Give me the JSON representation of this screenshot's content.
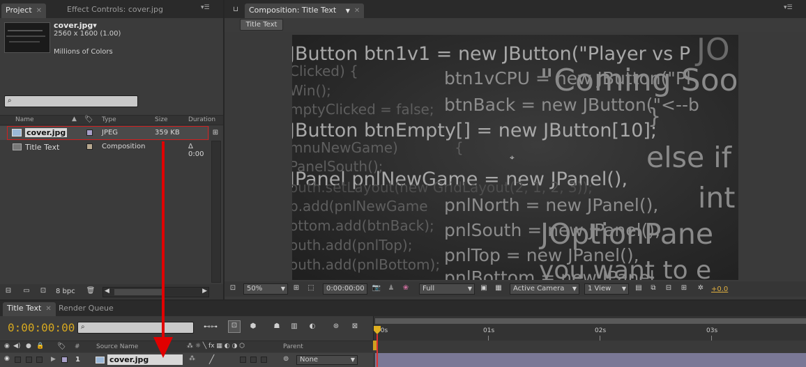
{
  "project_panel": {
    "tab_project": "Project",
    "tab_effect_controls": "Effect Controls: cover.jpg",
    "file_name": "cover.jpg▾",
    "file_dims": "2560 x 1600 (1.00)",
    "file_colors": "Millions of Colors",
    "search_placeholder": "",
    "columns": {
      "name": "Name",
      "type": "Type",
      "size": "Size",
      "duration": "Duration"
    },
    "items": [
      {
        "name": "cover.jpg",
        "type": "JPEG",
        "size": "359 KB",
        "duration": "",
        "label_color": "#a8a0c8",
        "icon": "image-icon"
      },
      {
        "name": "Title Text",
        "type": "Composition",
        "size": "",
        "duration": "Δ 0:00",
        "label_color": "#b8a890",
        "icon": "composition-icon"
      }
    ],
    "bpc": "8 bpc"
  },
  "composition_panel": {
    "tab_title": "Composition: Title Text",
    "comp_button": "Title Text",
    "zoom": "50%",
    "timecode": "0:00:00:00",
    "resolution": "Full",
    "camera": "Active Camera",
    "views": "1 View",
    "exposure": "+0.0"
  },
  "preview_text": [
    "JButton   btn1v1 = new JButton(\"Player vs P",
    "Clicked) {",
    "btn1vCPU = new JButton(\"Pl",
    "\"Coming Soo",
    "Win();",
    "mptyClicked = false;",
    "btnBack = new JButton(\"<--b",
    "}",
    "JButton btnEmpty[] = new JButton[10];",
    "mnuNewGame)",
    "{",
    "else if",
    "PanelSouth();",
    "JPanel    pnlNewGame = new JPanel(),",
    "outh.setLayout(new GridLayout(2, 1, 2, 3));",
    "int",
    "pnlNorth = new JPanel(),",
    "p.add(pnlNewGame",
    "pnlSouth = new JPanel(),",
    "ottom.add(btnBack);",
    "JOptionPane",
    "outh.add(pnlTop);",
    "pnlTop = new JPanel(),",
    "outh.add(pnlBottom);",
    "you want to e",
    "pnlBottom = new JPanel",
    "JO"
  ],
  "timeline_panel": {
    "tab_title_text": "Title Text",
    "tab_render_queue": "Render Queue",
    "timecode": "0:00:00:00",
    "search_placeholder": "",
    "columns": {
      "hash": "#",
      "source_name": "Source Name",
      "parent": "Parent"
    },
    "ruler": [
      "00s",
      "01s",
      "02s",
      "03s"
    ],
    "layers": [
      {
        "index": "1",
        "name": "cover.jpg",
        "parent": "None",
        "label_color": "#a8a0c8"
      }
    ]
  },
  "annotation": {
    "arrow_color": "#e00000",
    "highlight_color": "#d02020"
  }
}
